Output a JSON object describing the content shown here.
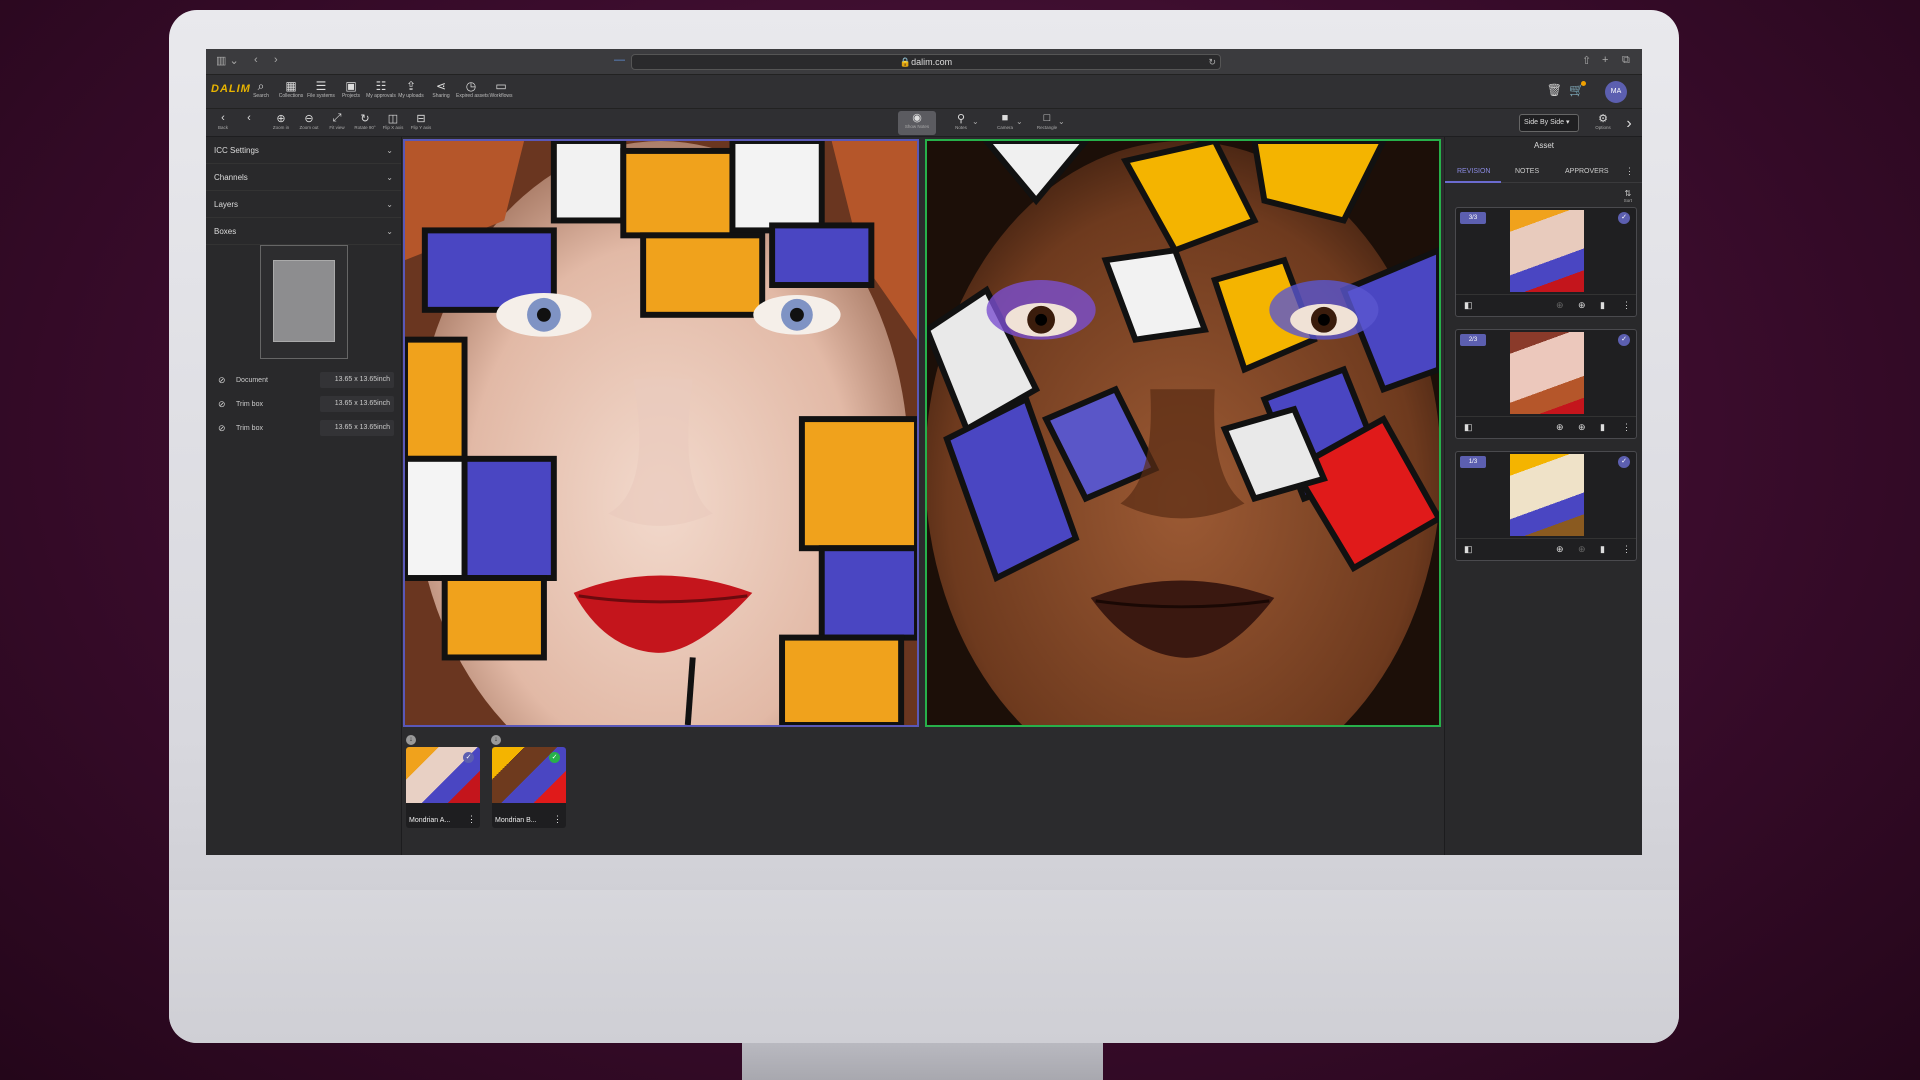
{
  "browser": {
    "url": "dalim.com"
  },
  "app": {
    "logo": "DALIM",
    "avatar": "MA",
    "nav": [
      {
        "icon": "search-icon",
        "glyph": "⌕",
        "label": "Search"
      },
      {
        "icon": "collections-icon",
        "glyph": "▦",
        "label": "Collections"
      },
      {
        "icon": "file-systems-icon",
        "glyph": "☰",
        "label": "File systems"
      },
      {
        "icon": "projects-icon",
        "glyph": "▣",
        "label": "Projects"
      },
      {
        "icon": "approvals-icon",
        "glyph": "☷",
        "label": "My approvals"
      },
      {
        "icon": "uploads-icon",
        "glyph": "⇪",
        "label": "My uploads"
      },
      {
        "icon": "sharing-icon",
        "glyph": "⋖",
        "label": "Sharing"
      },
      {
        "icon": "expired-icon",
        "glyph": "◷",
        "label": "Expired assets"
      },
      {
        "icon": "workflows-icon",
        "glyph": "▭",
        "label": "Workflows"
      }
    ]
  },
  "toolbar": {
    "left": [
      {
        "icon": "back-icon",
        "glyph": "‹",
        "label": "Back"
      },
      {
        "icon": "prev-icon",
        "glyph": "‹",
        "label": ""
      },
      {
        "icon": "zoom-in-icon",
        "glyph": "⊕",
        "label": "Zoom in"
      },
      {
        "icon": "zoom-out-icon",
        "glyph": "⊖",
        "label": "Zoom out"
      },
      {
        "icon": "fit-view-icon",
        "glyph": "⤢",
        "label": "Fit view"
      },
      {
        "icon": "rotate-icon",
        "glyph": "↻",
        "label": "Rotate 90°"
      },
      {
        "icon": "flip-x-icon",
        "glyph": "◫",
        "label": "Flip X axis"
      },
      {
        "icon": "flip-y-icon",
        "glyph": "⊟",
        "label": "Flip Y axis"
      }
    ],
    "center": [
      {
        "icon": "show-notes-icon",
        "glyph": "◉",
        "label": "Show Notes"
      },
      {
        "icon": "notes-pin-icon",
        "glyph": "⚲",
        "label": "Notes"
      },
      {
        "icon": "camera-icon",
        "glyph": "■",
        "label": "Camera"
      },
      {
        "icon": "rectangle-icon",
        "glyph": "□",
        "label": "Rectangle"
      }
    ],
    "view_mode": "Side By Side",
    "options_label": "Options"
  },
  "left_panel": {
    "sections": [
      "ICC Settings",
      "Channels",
      "Layers",
      "Boxes"
    ],
    "boxes": [
      {
        "label": "Document",
        "value": "13.65 x 13.65inch"
      },
      {
        "label": "Trim box",
        "value": "13.65 x 13.65inch"
      },
      {
        "label": "Trim box",
        "value": "13.65 x 13.65inch"
      }
    ]
  },
  "filmstrip": [
    {
      "caption": "Mondrian A...",
      "check_color": "#5c5fb0"
    },
    {
      "caption": "Mondrian B...",
      "check_color": "#27b04a"
    }
  ],
  "right_panel": {
    "title": "Asset",
    "tabs": [
      "REVISION",
      "NOTES",
      "APPROVERS"
    ],
    "sort_label": "Sort",
    "revisions": [
      {
        "badge": "3/3"
      },
      {
        "badge": "2/3"
      },
      {
        "badge": "1/3"
      }
    ]
  }
}
